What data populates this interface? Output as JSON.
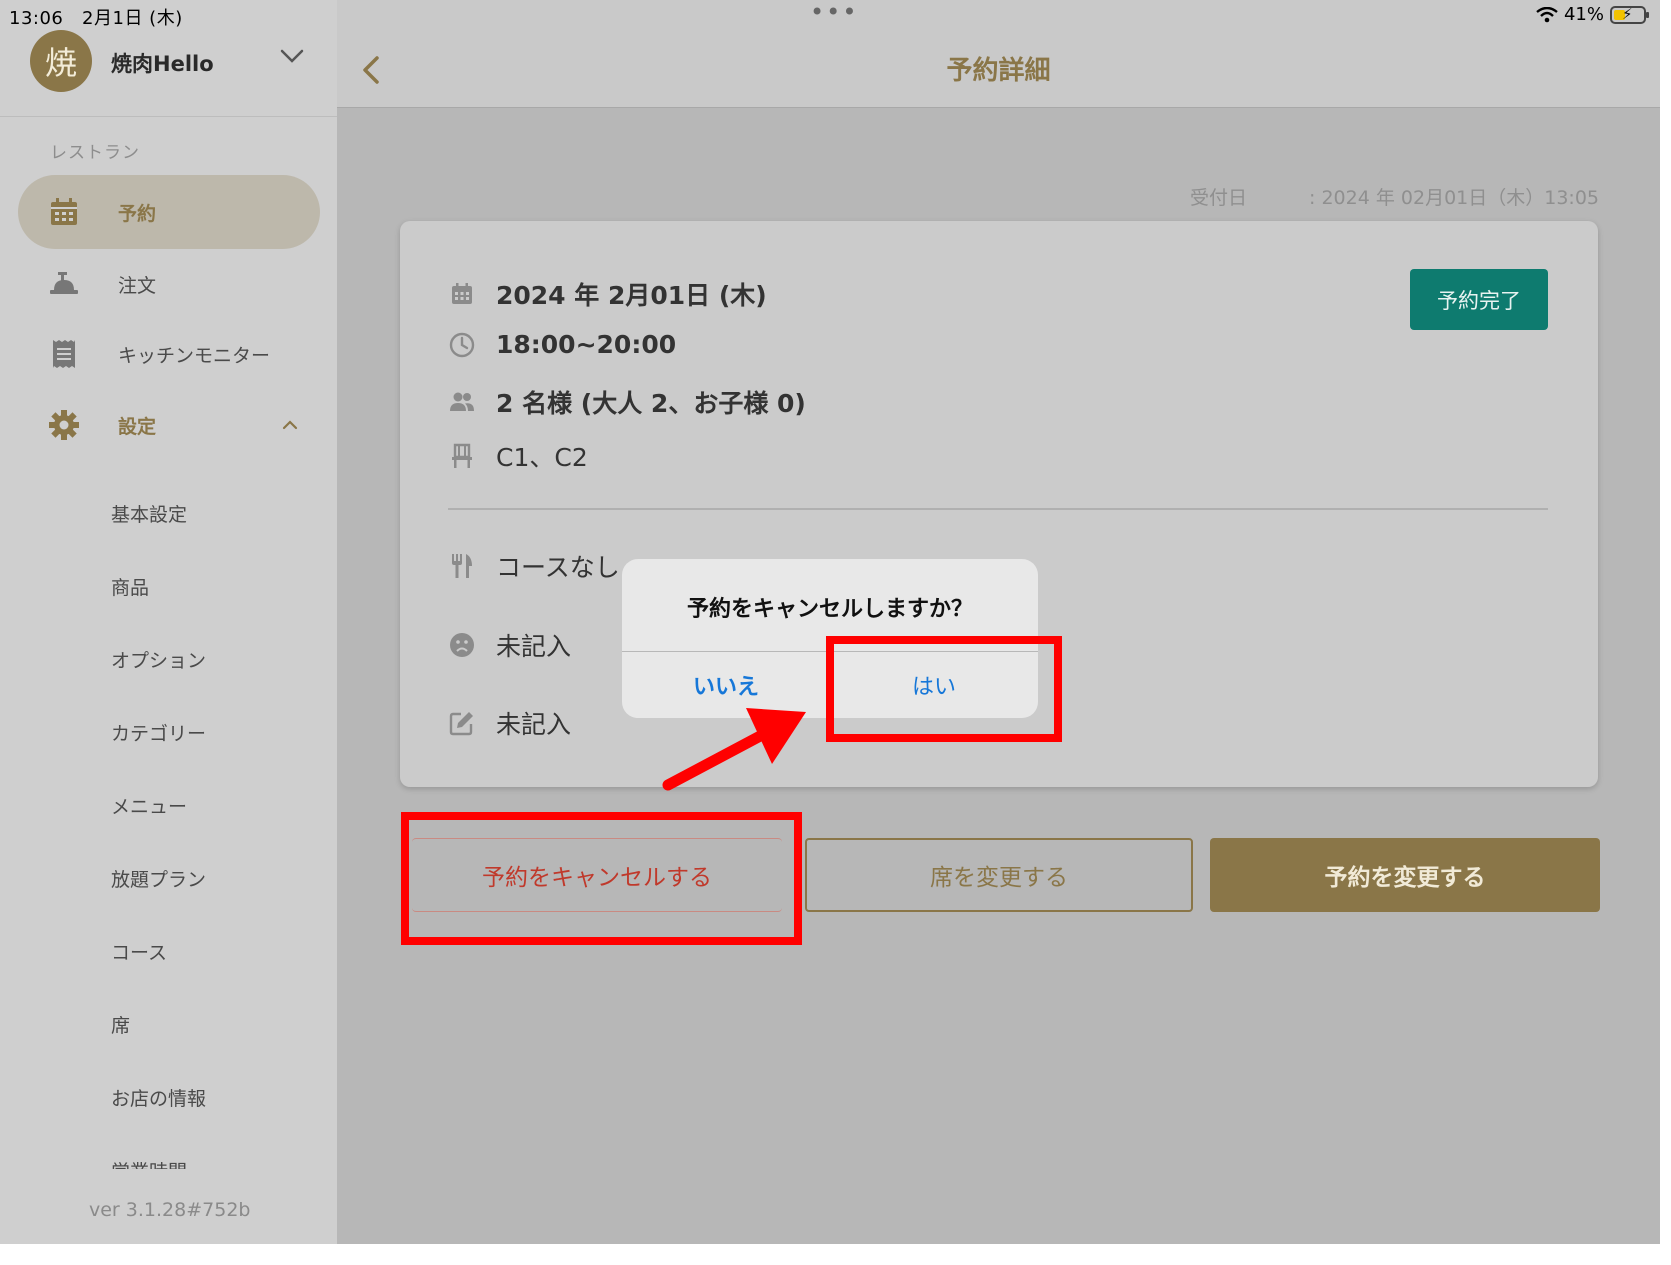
{
  "status_bar": {
    "time": "13:06",
    "date": "2月1日 (木)",
    "dots": "•••",
    "battery_percent": "41%",
    "battery_level": 0.41
  },
  "sidebar": {
    "avatar_letter": "焼",
    "store_name": "焼肉Hello",
    "section_label": "レストラン",
    "nav": [
      {
        "label": "予約",
        "icon": "calendar-icon"
      },
      {
        "label": "注文",
        "icon": "food-tray-icon"
      },
      {
        "label": "キッチンモニター",
        "icon": "receipt-icon"
      },
      {
        "label": "設定",
        "icon": "gear-icon"
      }
    ],
    "settings_items": [
      "基本設定",
      "商品",
      "オプション",
      "カテゴリー",
      "メニュー",
      "放題プラン",
      "コース",
      "席",
      "お店の情報",
      "営業時間"
    ],
    "version": "ver 3.1.28#752b"
  },
  "header": {
    "title": "予約詳細"
  },
  "reservation": {
    "received_label": "受付日",
    "received_value": ": 2024 年 02月01日（木）13:05",
    "date": "2024 年 2月01日 (木)",
    "time": "18:00~20:00",
    "party": "2 名様 (大人 2、お子様 0)",
    "seats": "C1、C2",
    "course": "コースなし",
    "allergy": "未記入",
    "memo": "未記入",
    "status_badge": "予約完了"
  },
  "actions": {
    "cancel": "予約をキャンセルする",
    "change_seat": "席を変更する",
    "change_reservation": "予約を変更する"
  },
  "dialog": {
    "title": "予約をキャンセルしますか？",
    "no": "いいえ",
    "yes": "はい"
  },
  "colors": {
    "gold": "#8a7648",
    "teal": "#0e7b6f",
    "danger": "#c0392b",
    "ios_blue": "#1677d8",
    "annotation_red": "#ff0000"
  }
}
